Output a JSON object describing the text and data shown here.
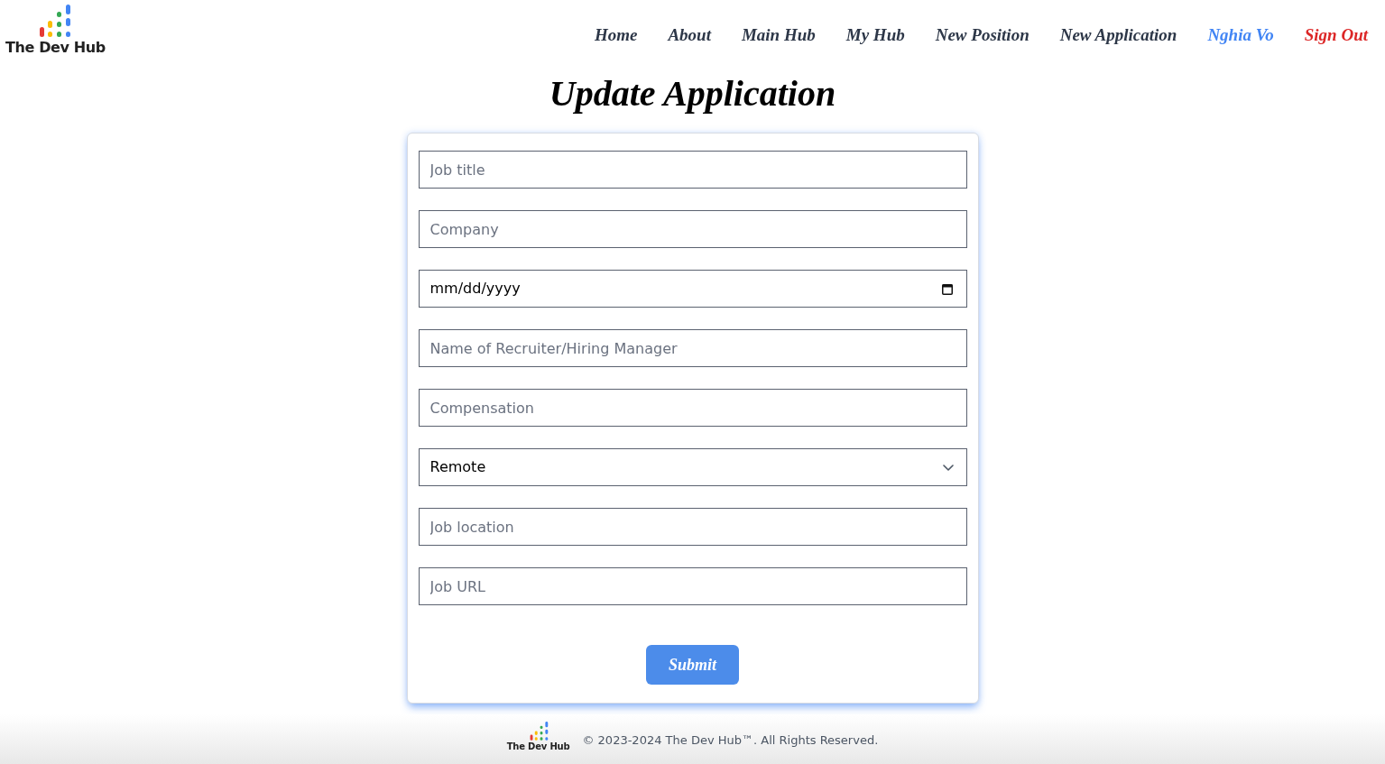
{
  "header": {
    "logo_text": "The Dev Hub",
    "nav": [
      {
        "label": "Home",
        "color": "#2d3748"
      },
      {
        "label": "About",
        "color": "#2d3748"
      },
      {
        "label": "Main Hub",
        "color": "#2d3748"
      },
      {
        "label": "My Hub",
        "color": "#2d3748"
      },
      {
        "label": "New Position",
        "color": "#2d3748"
      },
      {
        "label": "New Application",
        "color": "#2d3748"
      },
      {
        "label": "Nghia Vo",
        "color": "#4285f4"
      },
      {
        "label": "Sign Out",
        "color": "#dc2626"
      }
    ]
  },
  "title": "Update Application",
  "form": {
    "fields": [
      {
        "kind": "text",
        "placeholder": "Job title"
      },
      {
        "kind": "text",
        "placeholder": "Company"
      },
      {
        "kind": "date",
        "placeholder": "mm/dd/yyyy"
      },
      {
        "kind": "text",
        "placeholder": "Name of Recruiter/Hiring Manager"
      },
      {
        "kind": "text",
        "placeholder": "Compensation"
      },
      {
        "kind": "select",
        "value": "Remote"
      },
      {
        "kind": "text",
        "placeholder": "Job location"
      },
      {
        "kind": "text",
        "placeholder": "Job URL"
      }
    ],
    "submit": "Submit"
  },
  "footer": {
    "logo_text": "The Dev Hub",
    "copyright": "© 2023-2024 The Dev Hub™. All Rights Reserved."
  }
}
